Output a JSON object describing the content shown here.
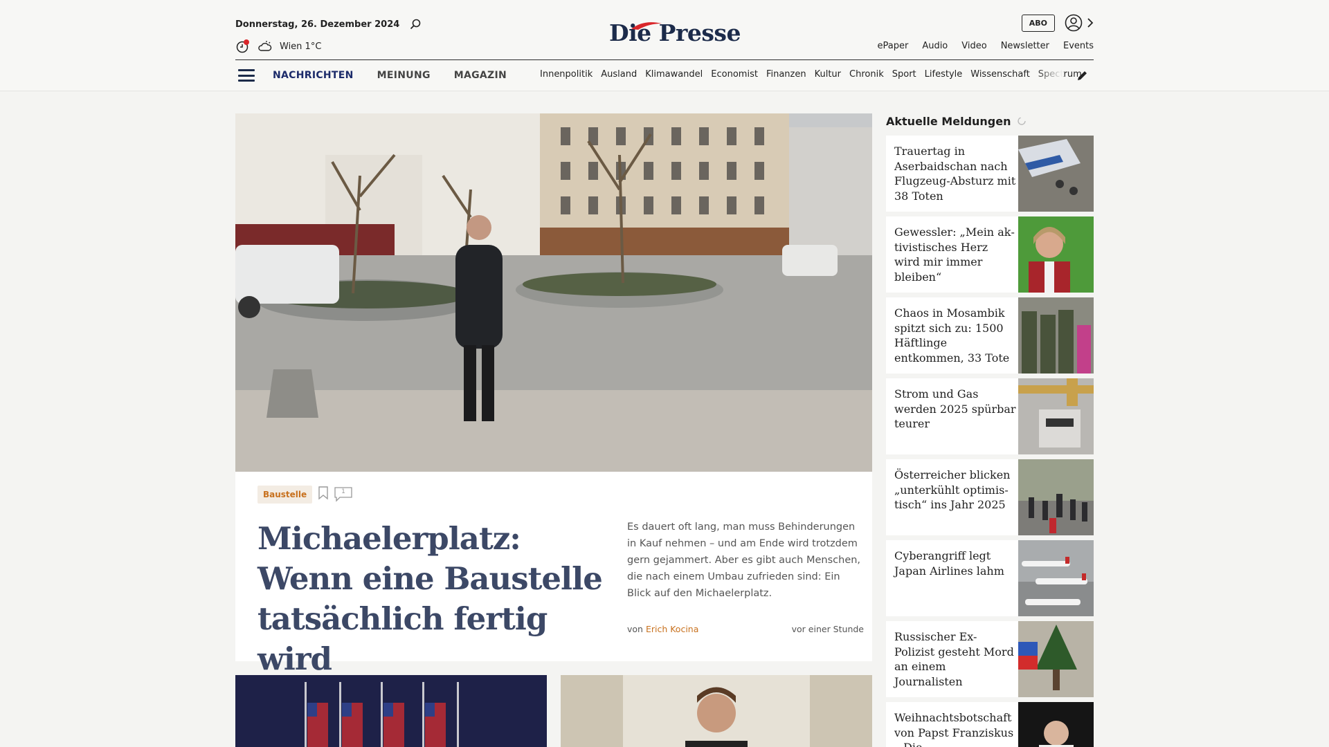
{
  "header": {
    "date": "Donnerstag, 26. Dezember 2024",
    "weather": "Wien 1°C",
    "logo_text": "Die Presse",
    "abo_label": "ABO",
    "links": [
      "ePaper",
      "Audio",
      "Video",
      "Newsletter",
      "Events"
    ]
  },
  "nav": {
    "main": [
      "NACHRICHTEN",
      "MEINUNG",
      "MAGAZIN"
    ],
    "sub": [
      "Innenpolitik",
      "Ausland",
      "Klimawandel",
      "Economist",
      "Finanzen",
      "Kultur",
      "Chronik",
      "Sport",
      "Lifestyle",
      "Wissenschaft",
      "Spectrum"
    ]
  },
  "lead": {
    "tag": "Baustelle",
    "comment_count": "1",
    "title": "Michaelerplatz: Wenn eine Baustelle tatsächlich fertig wird",
    "teaser": "Es dauert oft lang, man muss Behinderungen in Kauf nehmen – und am Ende wird trotzdem gern gejammert. Aber es gibt auch Menschen, die nach einem Umbau zufrieden sind: Ein Blick auf den Michaelerplatz.",
    "byline_prefix": "von",
    "author": "Erich Kocina",
    "time": "vor einer Stunde"
  },
  "sidebar": {
    "heading": "Aktuelle Meldungen",
    "items": [
      {
        "text": "Trauertag in Aserbaidschan nach Flugzeug-Absturz mit 38 Toten",
        "image": "plane-wreck-image"
      },
      {
        "text": "Gewessler: „Mein ak­tivistisches Herz wird mir immer bleiben“",
        "image": "politician-portrait-image"
      },
      {
        "text": "Chaos in Mosambik spitzt sich zu: 1500 Häftlinge entkommen, 33 Tote",
        "image": "soldiers-image"
      },
      {
        "text": "Strom und Gas werden 2025 spürbar teurer",
        "image": "gas-meter-image"
      },
      {
        "text": "Österreicher blicken „unterkühlt optimis­tisch“ ins Jahr 2025",
        "image": "street-crowd-image"
      },
      {
        "text": "Cyberangriff legt Japan Airlines lahm",
        "image": "airplanes-image"
      },
      {
        "text": "Russischer Ex-Polizist gesteht Mord an einem Journalisten",
        "image": "memorial-tree-image"
      },
      {
        "text": "Weihnachtsbotschaft von Papst Franziskus – Die",
        "image": "pope-image"
      }
    ]
  },
  "colors": {
    "brand_navy": "#1c2b4a",
    "brand_red": "#d9262a",
    "accent_orange": "#c8711e",
    "title_blue": "#3c4866"
  }
}
